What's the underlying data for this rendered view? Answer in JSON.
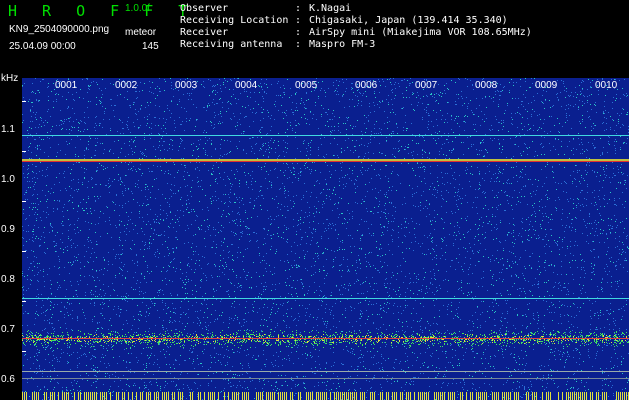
{
  "header": {
    "app_title": "H R O F F T",
    "version": "1.0.0f",
    "filename": "KN9_2504090000.png",
    "mode": "meteor",
    "datetime": "25.04.09 00:00",
    "count": "145"
  },
  "station_info": [
    {
      "label": "Observer",
      "sep": ":",
      "value": "K.Nagai"
    },
    {
      "label": "Receiving Location",
      "sep": ":",
      "value": "Chigasaki, Japan (139.414 35.340)"
    },
    {
      "label": "Receiver",
      "sep": ":",
      "value": "AirSpy mini (Miakejima VOR 108.65MHz)"
    },
    {
      "label": "Receiving antenna",
      "sep": ":",
      "value": "Maspro FM-3"
    }
  ],
  "y_axis": {
    "unit": "kHz",
    "ticks": [
      "1.1",
      "1.0",
      "0.9",
      "0.8",
      "0.7",
      "0.6"
    ]
  },
  "x_axis": {
    "labels": [
      "0001",
      "0002",
      "0003",
      "0004",
      "0005",
      "0006",
      "0007",
      "0008",
      "0009",
      "0010"
    ]
  },
  "colors": {
    "background": "#000000",
    "title_green": "#00e000",
    "waterfall_base": "#0a1f8f"
  }
}
